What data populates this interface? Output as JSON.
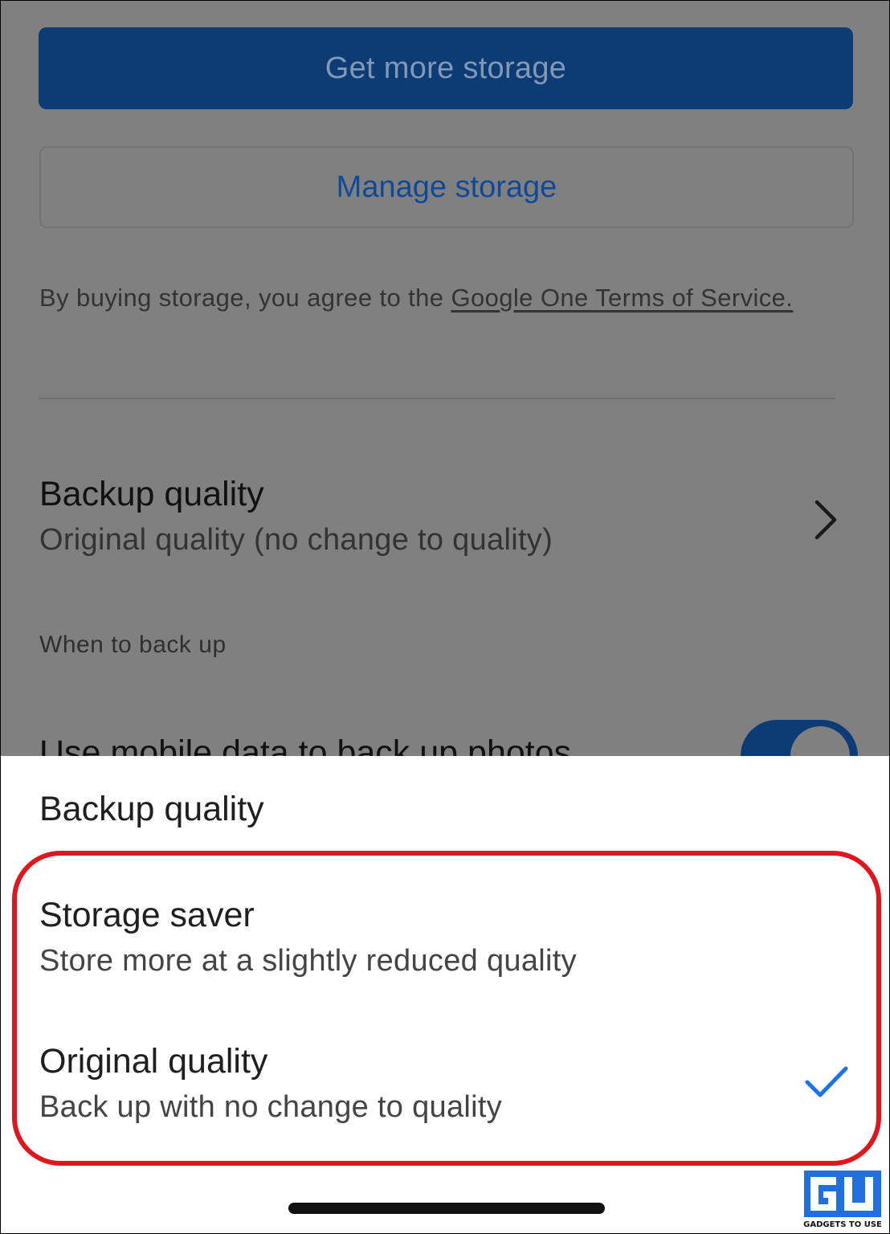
{
  "storage": {
    "get_more_label": "Get more storage",
    "manage_label": "Manage storage",
    "terms_prefix": "By buying storage, you agree to the ",
    "terms_link": "Google One Terms of Service."
  },
  "settings": {
    "backup_quality_title": "Backup quality",
    "backup_quality_value": "Original quality (no change to quality)",
    "when_to_back_up_label": "When to back up",
    "mobile_data_label": "Use mobile data to back up photos",
    "mobile_data_enabled": true
  },
  "sheet": {
    "title": "Backup quality",
    "options": [
      {
        "title": "Storage saver",
        "description": "Store more at a slightly reduced quality",
        "selected": false
      },
      {
        "title": "Original quality",
        "description": "Back up with no change to quality",
        "selected": true
      }
    ]
  },
  "watermark": {
    "text": "GADGETS TO USE"
  },
  "colors": {
    "primary_button": "#0d3b73",
    "link_blue": "#0f4a9a",
    "check_blue": "#1a73e8",
    "highlight_red": "#e0161e",
    "scrim_gray": "#808080"
  },
  "icons": {
    "chevron": "chevron-right-icon",
    "check": "checkmark-icon"
  }
}
